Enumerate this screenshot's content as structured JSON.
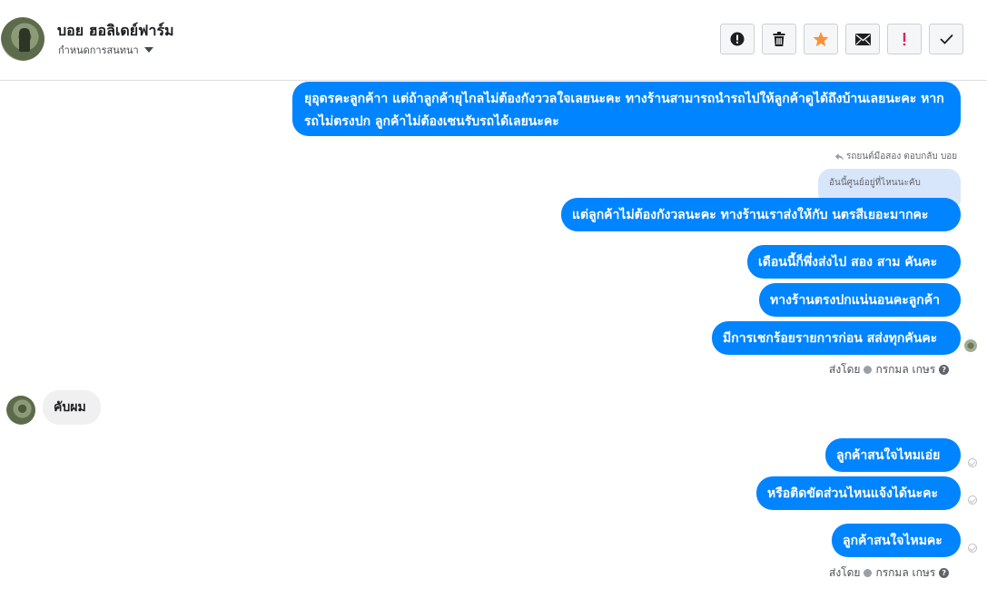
{
  "header": {
    "contact_name": "บอย ฮอลิเดย์ฟาร์ม",
    "conversation_setting_label": "กำหนดการสนทนา"
  },
  "toolbar": {
    "buttons": [
      {
        "name": "report-button",
        "icon": "alert-circle-icon"
      },
      {
        "name": "delete-button",
        "icon": "trash-icon"
      },
      {
        "name": "star-button",
        "icon": "star-icon",
        "color": "#f7923a"
      },
      {
        "name": "mark-unread-button",
        "icon": "envelope-icon"
      },
      {
        "name": "mark-spam-button",
        "icon": "exclamation-icon",
        "color": "#e0245e"
      },
      {
        "name": "mark-done-button",
        "icon": "checkmark-icon"
      }
    ]
  },
  "messages": {
    "m1": "ยุอุดรคะลูกค้าา แต่ถ้าลูกค้ายุไกลไม่ต้องกังววลใจเลยนะคะ ทางร้านสามารถนำรถไปให้ลูกค้าดูได้ถึงบ้านเลยนะคะ หากรถไม่ตรงปก ลูกค้าไม่ต้องเซนรับรถได้เลยนะคะ",
    "reply_note": "รถยนต์มือสอง ตอบกลับ บอย",
    "quoted": "อันนี้ศูนย์อยู่ที่ไหนนะคับ",
    "m2": "แต่ลูกค้าไม่ต้องกังวลนะคะ ทางร้านเราส่งให้กับ นตรสีเยอะมากคะ",
    "m3": "เดือนนี้ก็พึ่งส่งไป สอง สาม คันคะ",
    "m4": "ทางร้านตรงปกแน่นอนคะลูกค้า",
    "m5": "มีการเชกร้อยรายการก่อน สส่งทุกคันคะ",
    "sent_by_1": "ส่งโดย",
    "sender_name_1": "กรกมล เกษร",
    "incoming_1": "คับผม",
    "m6": "ลูกค้าสนใจไหมเอ่ย",
    "m7": "หรือติดขัดส่วนไหนแจ้งได้นะคะ",
    "m8": "ลูกค้าสนใจไหมคะ",
    "sent_by_2": "ส่งโดย",
    "sender_name_2": "กรกมล เกษร"
  },
  "colors": {
    "outgoing_bubble": "#0084ff",
    "incoming_bubble": "#f1f0f0",
    "quoted_bubble": "#d8e6fc"
  }
}
